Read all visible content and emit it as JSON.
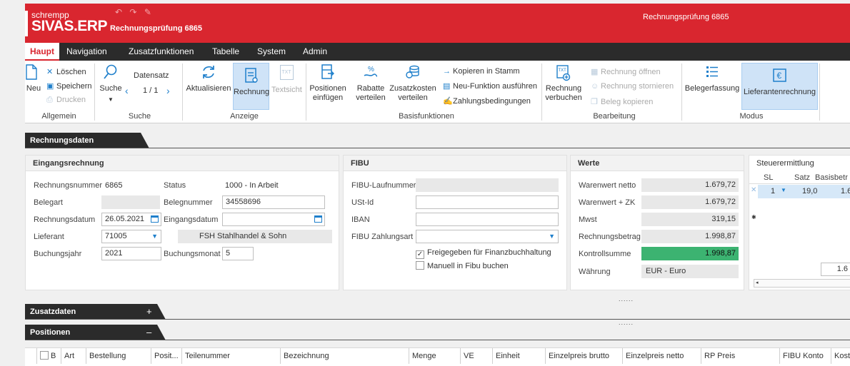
{
  "brand": {
    "small": "schrempp",
    "big": "SIVAS.ERP",
    "sub": "Rechnungsprüfung 6865"
  },
  "window_title": "Rechnungsprüfung 6865",
  "quick_access": [
    "↶",
    "↷",
    "✎"
  ],
  "menu": [
    {
      "label": "Haupt",
      "active": true
    },
    {
      "label": "Navigation"
    },
    {
      "label": "Zusatzfunktionen"
    },
    {
      "label": "Tabelle"
    },
    {
      "label": "System"
    },
    {
      "label": "Admin"
    }
  ],
  "ribbon": {
    "allgemein": {
      "label": "Allgemein",
      "neu": "Neu",
      "loeschen": "Löschen",
      "speichern": "Speichern",
      "drucken": "Drucken"
    },
    "suche": {
      "label": "Suche",
      "suche_btn": "Suche",
      "datensatz": "Datensatz",
      "record": "1 / 1"
    },
    "anzeige": {
      "label": "Anzeige",
      "aktualisieren": "Aktualisieren",
      "rechnung": "Rechnung",
      "textsicht": "Textsicht"
    },
    "basis": {
      "label": "Basisfunktionen",
      "positionen": "Positionen",
      "positionen2": "einfügen",
      "rabatte": "Rabatte",
      "rabatte2": "verteilen",
      "zusatzkosten": "Zusatzkosten",
      "zusatzkosten2": "verteilen",
      "kopieren": "Kopieren in Stamm",
      "neufunktion": "Neu-Funktion ausführen",
      "zahlung": "Zahlungsbedingungen"
    },
    "bearbeitung": {
      "label": "Bearbeitung",
      "buchen": "Rechnung",
      "buchen2": "verbuchen",
      "oeffnen": "Rechnung öffnen",
      "stornieren": "Rechnung stornieren",
      "beleg": "Beleg kopieren"
    },
    "modus": {
      "label": "Modus",
      "belegerfassung": "Belegerfassung",
      "lieferanten": "Lieferantenrechnung"
    },
    "icon_txt": "TXT",
    "icon_txt_plus": "TXT"
  },
  "sections": {
    "rechnungsdaten": "Rechnungsdaten",
    "zusatzdaten": "Zusatzdaten",
    "zusatz_toggle": "+",
    "positionen": "Positionen",
    "positionen_toggle": "–",
    "dots": "......"
  },
  "eingang": {
    "title": "Eingangsrechnung",
    "rechnungsnummer_label": "Rechnungsnummer",
    "rechnungsnummer": "6865",
    "status_label": "Status",
    "status": "1000 - In Arbeit",
    "belegart_label": "Belegart",
    "belegnummer_label": "Belegnummer",
    "belegnummer": "34558696",
    "rechnungsdatum_label": "Rechnungsdatum",
    "rechnungsdatum": "26.05.2021",
    "eingangsdatum_label": "Eingangsdatum",
    "lieferant_label": "Lieferant",
    "lieferant": "71005",
    "lieferant_name": "FSH Stahlhandel & Sohn",
    "buchungsjahr_label": "Buchungsjahr",
    "buchungsjahr": "2021",
    "buchungsmonat_label": "Buchungsmonat",
    "buchungsmonat": "5"
  },
  "fibu": {
    "title": "FIBU",
    "laufnummer_label": "FIBU-Laufnummer",
    "ustid_label": "USt-Id",
    "iban_label": "IBAN",
    "zahlungsart_label": "FIBU Zahlungsart",
    "freigegeben": "Freigegeben für Finanzbuchhaltung",
    "manuell": "Manuell in Fibu buchen"
  },
  "werte": {
    "title": "Werte",
    "rows": [
      {
        "label": "Warenwert netto",
        "value": "1.679,72"
      },
      {
        "label": "Warenwert + ZK",
        "value": "1.679,72"
      },
      {
        "label": "Mwst",
        "value": "319,15"
      },
      {
        "label": "Rechnungsbetrag",
        "value": "1.998,87"
      },
      {
        "label": "Kontrollsumme",
        "value": "1.998,87"
      }
    ],
    "waehrung_label": "Währung",
    "waehrung": "EUR - Euro"
  },
  "steuer": {
    "title": "Steuerermittlung",
    "cols": [
      "SL",
      "Satz",
      "Basisbetr"
    ],
    "row": {
      "sl": "1",
      "satz": "19,0",
      "basis": "1.6"
    },
    "total": "1.6",
    "new_row_marker": "✱",
    "row_marker": "✕"
  },
  "positionen_cols": [
    "B",
    "Art",
    "Bestellung",
    "Posit...",
    "Teilenummer",
    "Bezeichnung",
    "Menge",
    "VE",
    "Einheit",
    "Einzelpreis brutto",
    "Einzelpreis netto",
    "RP Preis",
    "FIBU Konto",
    "Kost"
  ],
  "colors": {
    "brand_red": "#d9262f",
    "dark": "#2b2b2b",
    "accent_blue": "#1e7fcb",
    "green": "#3cb371"
  }
}
